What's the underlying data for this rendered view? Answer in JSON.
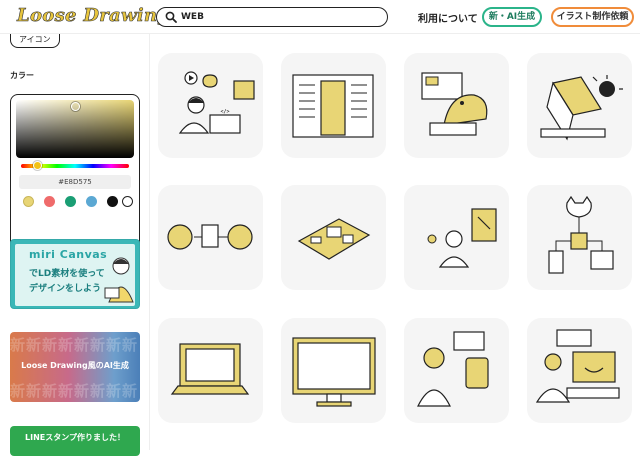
{
  "header": {
    "logo": "Loose Drawing",
    "search_value": "WEB",
    "nav_usage": "利用について",
    "new_ai_button": "新・AI生成",
    "request_button": "イラスト制作依頼"
  },
  "sidebar": {
    "tag_label": "アイコン",
    "color_section_title": "カラー",
    "color_picker": {
      "hex_value": "#E8D575",
      "swatches": [
        "#e8d575",
        "#ef6b6b",
        "#1a9e74",
        "#5ba8d3",
        "#111111",
        "#ffffff"
      ]
    },
    "banners": {
      "miricanvas": {
        "brand": "miri Canvas",
        "line1": "でLD素材を使って",
        "line2": "デザインをしよう"
      },
      "ai": {
        "watermark": "新新新新新新新新",
        "caption": "Loose Drawing風のAI生成"
      },
      "line": {
        "caption": "LINEスタンプ作りました！"
      }
    }
  },
  "grid": {
    "items": [
      {
        "icon": "person-computer-audio-code"
      },
      {
        "icon": "server-building"
      },
      {
        "icon": "dinosaur-laptop-404"
      },
      {
        "icon": "laptop-virus-broken"
      },
      {
        "icon": "people-document-exchange"
      },
      {
        "icon": "circuit-board"
      },
      {
        "icon": "person-workflow-document"
      },
      {
        "icon": "cat-devices-network"
      },
      {
        "icon": "laptop"
      },
      {
        "icon": "monitor-display"
      },
      {
        "icon": "person-tablet-app"
      },
      {
        "icon": "person-laptop-smile"
      }
    ]
  },
  "colors": {
    "accent": "#e8d575",
    "brand_green": "#2bb48a",
    "brand_orange": "#f08c3a"
  }
}
